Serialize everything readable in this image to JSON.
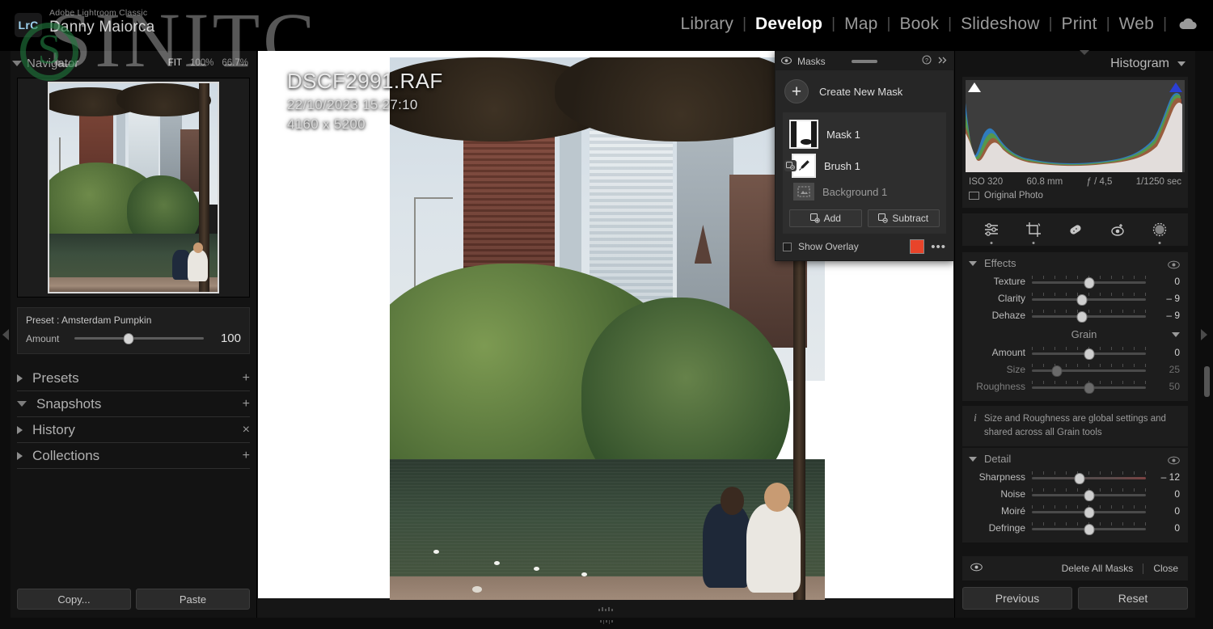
{
  "app": {
    "brand_badge": "LrC",
    "product": "Adobe Lightroom Classic",
    "user": "Danny Maiorca",
    "watermark": "SINITC"
  },
  "modules": {
    "items": [
      {
        "label": "Library",
        "active": false
      },
      {
        "label": "Develop",
        "active": true
      },
      {
        "label": "Map",
        "active": false
      },
      {
        "label": "Book",
        "active": false
      },
      {
        "label": "Slideshow",
        "active": false
      },
      {
        "label": "Print",
        "active": false
      },
      {
        "label": "Web",
        "active": false
      }
    ],
    "separator": "|",
    "cloud_icon": "cloud-icon"
  },
  "navigator": {
    "title": "Navigator",
    "zoom_options": [
      {
        "label": "FIT",
        "selected": true
      },
      {
        "label": "100%",
        "selected": false
      },
      {
        "label": "66.7%",
        "selected": false
      }
    ]
  },
  "preset": {
    "label": "Preset : Amsterdam Pumpkin",
    "amount_label": "Amount",
    "amount_value": "100",
    "amount_pct": 42
  },
  "left_panels": [
    {
      "name": "Presets",
      "expanded": false,
      "action": "+"
    },
    {
      "name": "Snapshots",
      "expanded": true,
      "action": "+"
    },
    {
      "name": "History",
      "expanded": false,
      "action": "×"
    },
    {
      "name": "Collections",
      "expanded": false,
      "action": "+"
    }
  ],
  "left_buttons": {
    "copy": "Copy...",
    "paste": "Paste"
  },
  "photo_info": {
    "filename": "DSCF2991.RAF",
    "datetime": "22/10/2023 15:27:10",
    "dimensions": "4160 x 5200"
  },
  "masks_panel": {
    "title": "Masks",
    "eye_icon": "eye-icon",
    "help_icon": "help-icon",
    "collapse_icon": "chevron-double-right-icon",
    "create_new_mask": "Create New Mask",
    "items": [
      {
        "name": "Mask 1",
        "type": "mask-thumbnail",
        "dim": false
      },
      {
        "name": "Brush 1",
        "type": "brush-icon",
        "dim": false
      },
      {
        "name": "Background 1",
        "type": "background-icon",
        "dim": true
      }
    ],
    "add_label": "Add",
    "subtract_label": "Subtract",
    "show_overlay_label": "Show Overlay",
    "show_overlay_checked": false,
    "overlay_color": "#E8442A",
    "more_menu": "•••"
  },
  "histogram": {
    "title": "Histogram",
    "exif": {
      "iso": "ISO 320",
      "focal": "60.8 mm",
      "aperture": "ƒ / 4,5",
      "shutter": "1/1250 sec"
    },
    "original_photo": "Original Photo",
    "clip_left": "shadow-clipping-indicator",
    "clip_right": "highlight-clipping-indicator"
  },
  "tools": [
    {
      "name": "basic-adjustments-icon",
      "dot": true
    },
    {
      "name": "crop-overlay-icon",
      "dot": true
    },
    {
      "name": "spot-removal-icon",
      "dot": false
    },
    {
      "name": "red-eye-correction-icon",
      "dot": false
    },
    {
      "name": "masking-icon",
      "dot": true
    }
  ],
  "effects": {
    "title": "Effects",
    "sliders": [
      {
        "label": "Texture",
        "value": "0",
        "pct": 50,
        "dim": false,
        "warm": false
      },
      {
        "label": "Clarity",
        "value": "– 9",
        "pct": 44,
        "dim": false,
        "warm": false
      },
      {
        "label": "Dehaze",
        "value": "– 9",
        "pct": 44,
        "dim": false,
        "warm": false
      }
    ],
    "grain": {
      "title": "Grain",
      "sliders": [
        {
          "label": "Amount",
          "value": "0",
          "pct": 50,
          "dim": false,
          "warm": false
        },
        {
          "label": "Size",
          "value": "25",
          "pct": 22,
          "dim": true,
          "warm": false
        },
        {
          "label": "Roughness",
          "value": "50",
          "pct": 50,
          "dim": true,
          "warm": false
        }
      ]
    },
    "note": "Size and Roughness are global settings and shared across all Grain tools"
  },
  "detail": {
    "title": "Detail",
    "sliders": [
      {
        "label": "Sharpness",
        "value": "– 12",
        "pct": 42,
        "dim": false,
        "warm": true
      },
      {
        "label": "Noise",
        "value": "0",
        "pct": 50,
        "dim": false,
        "warm": false
      },
      {
        "label": "Moiré",
        "value": "0",
        "pct": 50,
        "dim": false,
        "warm": false
      },
      {
        "label": "Defringe",
        "value": "0",
        "pct": 50,
        "dim": false,
        "warm": false
      }
    ]
  },
  "mask_footer": {
    "eye_icon": "eye-icon",
    "delete_all": "Delete All Masks",
    "close": "Close"
  },
  "right_buttons": {
    "previous": "Previous",
    "reset": "Reset"
  }
}
